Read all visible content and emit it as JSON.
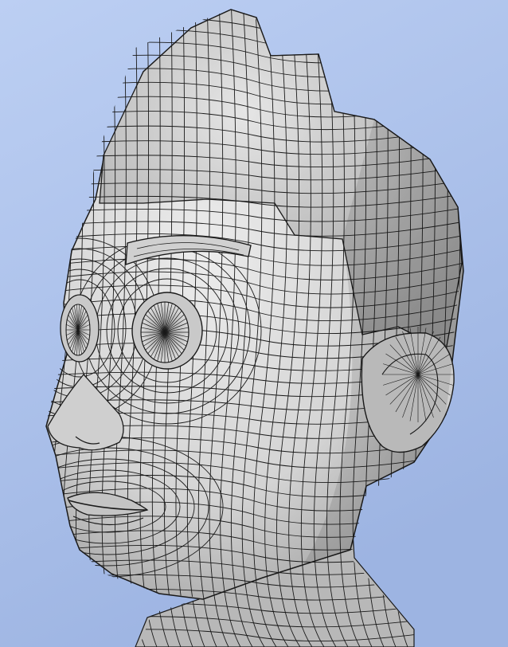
{
  "viewport": {
    "background_top": "#b9cdf2",
    "background_bottom": "#9fb6e4"
  },
  "model": {
    "subject": "stylized-character-head",
    "display_mode": "wireframe-on-shaded",
    "surface_color": "#d9d9d9",
    "shadow_color": "#8a8a8a",
    "wire_color": "#1a1a1a"
  }
}
